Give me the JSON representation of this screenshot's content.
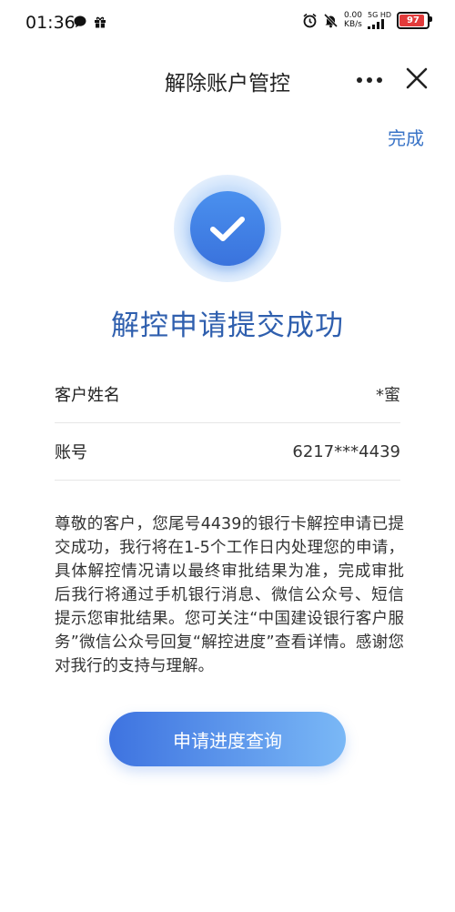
{
  "status_bar": {
    "time": "01:36",
    "net_speed_value": "0.00",
    "net_speed_unit": "KB/s",
    "signal_label": "5G HD",
    "battery": "97",
    "battery_level": 0.97,
    "left_icons": [
      "chat-bubble-icon",
      "gift-icon"
    ],
    "right_icons": [
      "alarm-icon",
      "mute-icon",
      "signal-icon"
    ]
  },
  "header": {
    "title": "解除账户管控",
    "more_icon": "more-dots-icon",
    "close_icon": "close-icon"
  },
  "action": {
    "done_label": "完成"
  },
  "result": {
    "icon": "checkmark-icon",
    "heading": "解控申请提交成功",
    "accent_color": "#3a74c7"
  },
  "info": [
    {
      "label": "客户姓名",
      "value": "*蜜"
    },
    {
      "label": "账号",
      "value": "6217***4439"
    }
  ],
  "notice": "尊敬的客户，您尾号4439的银行卡解控申请已提交成功，我行将在1-5个工作日内处理您的申请，具体解控情况请以最终审批结果为准，完成审批后我行将通过手机银行消息、微信公众号、短信提示您审批结果。您可关注“中国建设银行客户服务”微信公众号回复“解控进度”查看详情。感谢您对我行的支持与理解。",
  "primary_button": {
    "label": "申请进度查询"
  }
}
